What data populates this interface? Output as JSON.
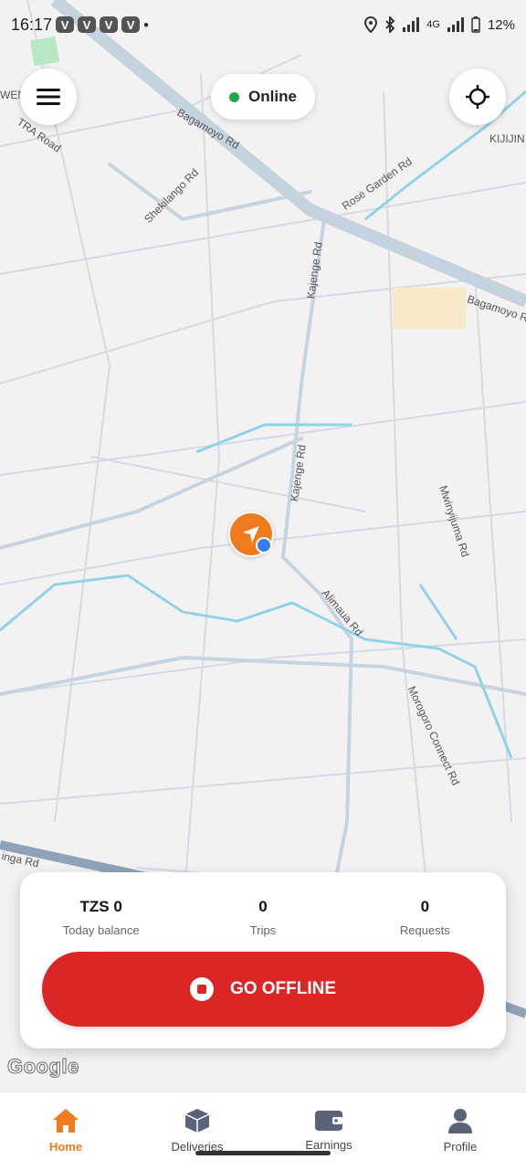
{
  "status_bar": {
    "time": "16:17",
    "notifications": [
      "V",
      "V",
      "V",
      "V"
    ],
    "network": "4G",
    "battery": "12%"
  },
  "header": {
    "status_label": "Online",
    "status_color": "#1fa64a"
  },
  "map": {
    "road_labels": [
      "Bagamoyo Rd",
      "TRA Road",
      "Shekilango Rd",
      "Rose Garden Rd",
      "KIJIJIN",
      "Bagamoyo Rd",
      "Kajenge Rd",
      "Kajenge Rd",
      "Mwinyijuma Rd",
      "Alimaua Rd",
      "Morogoro Connect Rd",
      "inga Rd",
      "WENG"
    ],
    "attribution": "Google",
    "marker_color": "#f07b1e",
    "gps_color": "#3b7de8"
  },
  "summary": {
    "balance_value": "TZS 0",
    "balance_label": "Today balance",
    "trips_value": "0",
    "trips_label": "Trips",
    "requests_value": "0",
    "requests_label": "Requests"
  },
  "action": {
    "label": "GO OFFLINE",
    "color": "#dc2626"
  },
  "nav": {
    "active_color": "#f07b1e",
    "items": [
      {
        "label": "Home",
        "icon": "home-icon"
      },
      {
        "label": "Deliveries",
        "icon": "box-icon"
      },
      {
        "label": "Earnings",
        "icon": "wallet-icon"
      },
      {
        "label": "Profile",
        "icon": "person-icon"
      }
    ]
  }
}
